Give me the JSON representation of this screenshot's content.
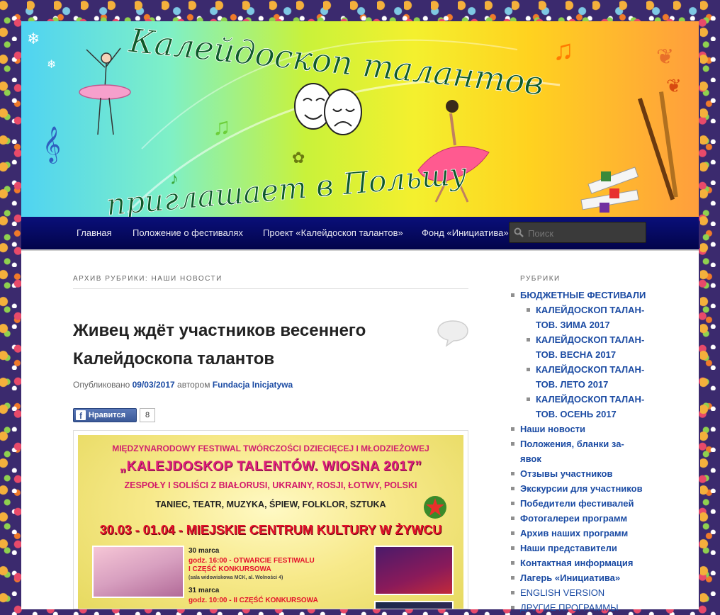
{
  "banner": {
    "title_line1": "Калейдоскоп талантов",
    "title_line2": "приглашает в Польшу"
  },
  "nav": {
    "items": [
      {
        "label": "Главная"
      },
      {
        "label": "Положение о фестивалях"
      },
      {
        "label": "Проект «Калейдоскоп талантов»"
      },
      {
        "label": "Фонд «Инициатива»"
      }
    ],
    "search_placeholder": "Поиск"
  },
  "main": {
    "archive_title": "АРХИВ РУБРИКИ: НАШИ НОВОСТИ",
    "post": {
      "title_line1": "Живец ждёт участников весеннего",
      "title_line2": "Калейдоскопа талантов",
      "meta_prefix": "Опубликовано",
      "date": "09/03/2017",
      "meta_author_prefix": "автором",
      "author": "Fundacja Inicjatywa",
      "like_label": "Нравится",
      "like_count": "8"
    },
    "poster": {
      "line1": "MIĘDZYNARODOWY FESTIWAL TWÓRCZOŚCI DZIECIĘCEJ I MŁODZIEŻOWEJ",
      "line2": "„KALEJDOSKOP TALENTÓW. WIOSNA 2017”",
      "line3": "ZESPOŁY I SOLIŚCI Z BIAŁORUSI, UKRAINY, ROSJI, ŁOTWY, POLSKI",
      "line4": "TANIEC, TEATR, MUZYKA, ŚPIEW, FOLKLOR, SZTUKA",
      "line5": "30.03 - 01.04 - MIEJSKIE CENTRUM KULTURY W ŻYWCU",
      "day1": "30 marca",
      "day1_time": "godz. 16:00 - OTWARCIE FESTIWALU",
      "day1_event": "I CZĘŚĆ KONKURSOWA",
      "day1_place": "(sala widowiskowa MCK, al. Wolności 4)",
      "day2": "31 marca",
      "day2_time": "godz. 10:00 - II CZĘŚĆ KONKURSOWA"
    }
  },
  "sidebar": {
    "title": "РУБРИКИ",
    "items": [
      {
        "label": "БЮДЖЕТНЫЕ ФЕСТИВАЛИ"
      },
      {
        "label": "КАЛЕЙДОСКОП ТАЛАН-ТОВ. ЗИМА 2017"
      },
      {
        "label": "КАЛЕЙДОСКОП ТАЛАН-ТОВ. ВЕСНА 2017"
      },
      {
        "label": "КАЛЕЙДОСКОП ТАЛАН-ТОВ. ЛЕТО 2017"
      },
      {
        "label": "КАЛЕЙДОСКОП ТАЛАН-ТОВ. ОСЕНЬ 2017"
      },
      {
        "label": "Наши новости"
      },
      {
        "label": "Положения, бланки за-явок"
      },
      {
        "label": "Отзывы участников"
      },
      {
        "label": "Экскурсии для участников"
      },
      {
        "label": "Победители фестивалей"
      },
      {
        "label": "Фотогалереи программ"
      },
      {
        "label": "Архив наших программ"
      },
      {
        "label": "Наши представители"
      },
      {
        "label": "Контактная информация"
      },
      {
        "label": "Лагерь «Инициатива»"
      },
      {
        "label": "ENGLISH VERSION"
      },
      {
        "label": "ДРУГИЕ ПРОГРАММЫ"
      }
    ]
  },
  "colors": {
    "nav_bg": "#02044a",
    "link": "#1b4ba3",
    "facebook": "#3b5998"
  }
}
